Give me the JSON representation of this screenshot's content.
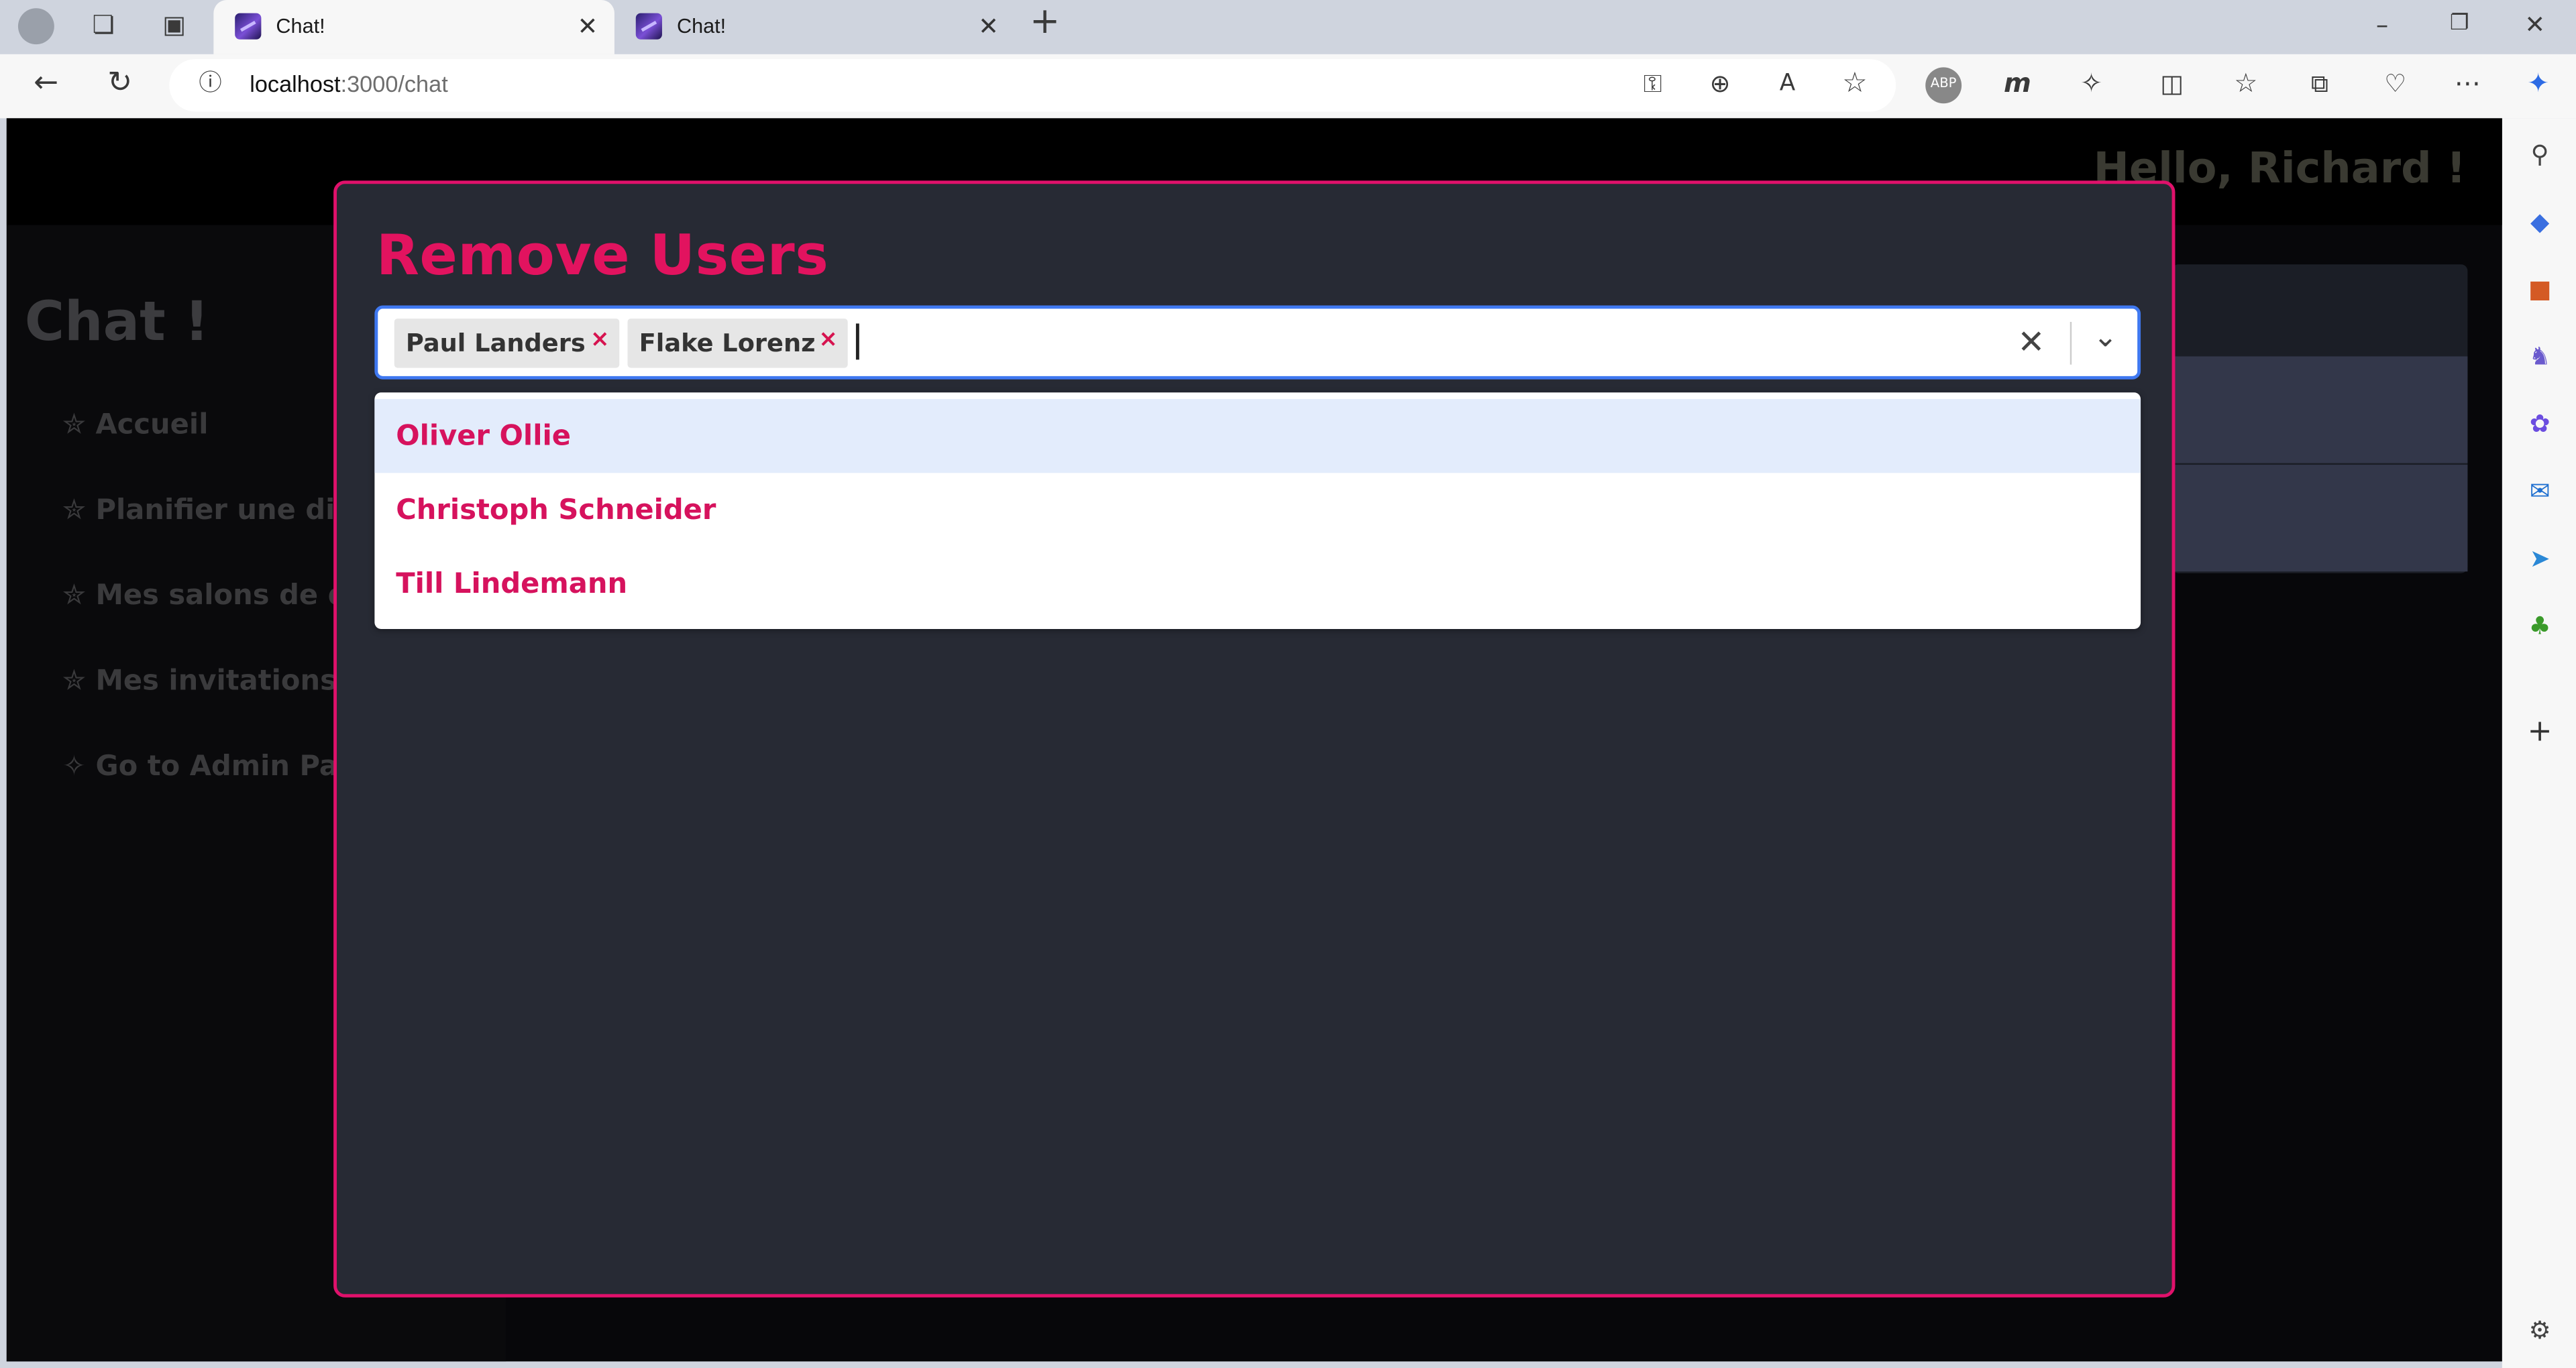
{
  "browser": {
    "tabs": [
      {
        "title": "Chat!",
        "close": "✕"
      },
      {
        "title": "Chat!",
        "close": "✕"
      }
    ],
    "new_tab": "+",
    "url_host": "localhost",
    "url_path": ":3000/chat",
    "window_controls": [
      "–",
      "❐",
      "✕"
    ]
  },
  "page": {
    "greeting": "Hello, Richard !",
    "sidebar_title": "Chat !",
    "nav": [
      {
        "icon": "✮",
        "label": "Accueil"
      },
      {
        "icon": "✮",
        "label": "Planifier une discussion"
      },
      {
        "icon": "✮",
        "label": "Mes salons de discussion"
      },
      {
        "icon": "✮",
        "label": "Mes invitations"
      },
      {
        "icon": "✧",
        "label": "Go to Admin Page"
      }
    ]
  },
  "modal": {
    "title": "Remove Users",
    "selected": [
      {
        "label": "Paul Landers",
        "remove": "×"
      },
      {
        "label": "Flake Lorenz",
        "remove": "×"
      }
    ],
    "clear_icon": "✕",
    "dropdown_icon": "⌄",
    "options": [
      "Oliver Ollie",
      "Christoph Schneider",
      "Till Lindemann"
    ],
    "highlighted_option": "Oliver Ollie"
  },
  "colors": {
    "accent": "#e2135f",
    "modal_bg": "#272a34",
    "focus_border": "#3f78f0",
    "option_highlight": "#e3ecfc"
  }
}
